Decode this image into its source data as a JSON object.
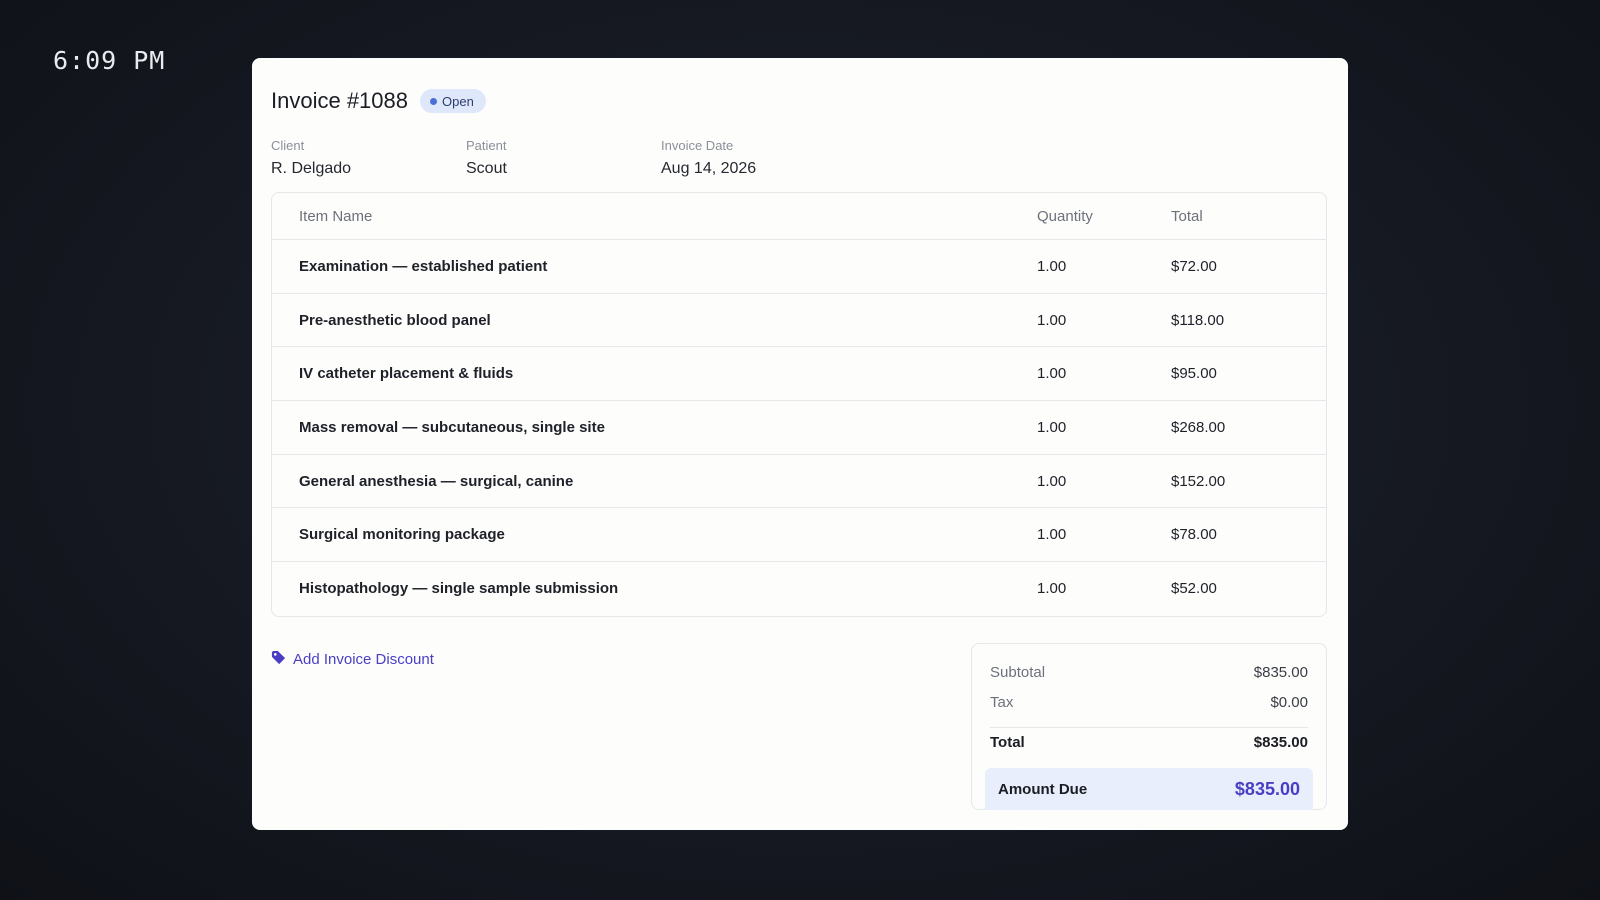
{
  "clock": "6:09 PM",
  "invoice": {
    "title": "Invoice #1088",
    "status": "Open",
    "status_color": "#4a6fd6"
  },
  "meta": {
    "client_label": "Client",
    "client": "R. Delgado",
    "patient_label": "Patient",
    "patient": "Scout",
    "date_label": "Invoice Date",
    "date": "Aug 14, 2026"
  },
  "table": {
    "headers": {
      "name": "Item Name",
      "quantity": "Quantity",
      "total": "Total"
    },
    "rows": [
      {
        "name": "Examination — established patient",
        "quantity": "1.00",
        "total": "$72.00"
      },
      {
        "name": "Pre-anesthetic blood panel",
        "quantity": "1.00",
        "total": "$118.00"
      },
      {
        "name": "IV catheter placement & fluids",
        "quantity": "1.00",
        "total": "$95.00"
      },
      {
        "name": "Mass removal — subcutaneous, single site",
        "quantity": "1.00",
        "total": "$268.00"
      },
      {
        "name": "General anesthesia — surgical, canine",
        "quantity": "1.00",
        "total": "$152.00"
      },
      {
        "name": "Surgical monitoring package",
        "quantity": "1.00",
        "total": "$78.00"
      },
      {
        "name": "Histopathology — single sample submission",
        "quantity": "1.00",
        "total": "$52.00"
      }
    ]
  },
  "discount": {
    "label": "Add Invoice Discount",
    "icon": "tag-icon",
    "color": "#4a3fc4"
  },
  "summary": {
    "subtotal_label": "Subtotal",
    "subtotal": "$835.00",
    "tax_label": "Tax",
    "tax": "$0.00",
    "total_label": "Total",
    "total": "$835.00",
    "due_label": "Amount Due",
    "due": "$835.00",
    "accent": "#4a3fc4"
  }
}
